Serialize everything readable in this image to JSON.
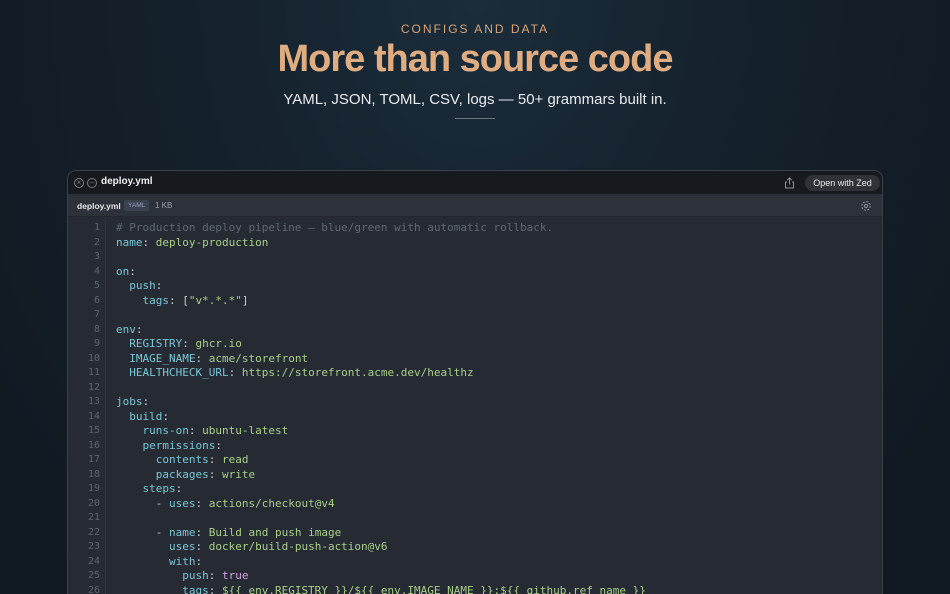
{
  "hero": {
    "eyebrow": "CONFIGS AND DATA",
    "headline": "More than source code",
    "subhead": "YAML, JSON, TOML, CSV, logs — 50+ grammars built in."
  },
  "window": {
    "title": "deploy.yml",
    "open_button": "Open with Zed",
    "icons": [
      "close-icon",
      "minimize-icon",
      "share-icon",
      "gear-icon"
    ],
    "tab": {
      "file": "deploy.yml",
      "language": "YAML",
      "size": "1 KB"
    }
  },
  "colors": {
    "accent": "#e0ad82",
    "key": "#79c7d8",
    "string": "#a8cf8a",
    "boolean": "#d7a2e6",
    "comment": "#5f6873"
  },
  "code_lines": [
    {
      "num": "1",
      "parts": [
        {
          "t": "# Production deploy pipeline — blue/green with automatic rollback.",
          "c": "comment"
        }
      ]
    },
    {
      "num": "2",
      "parts": [
        {
          "t": "name",
          "c": "key"
        },
        {
          "t": ": ",
          "c": "punct"
        },
        {
          "t": "deploy-production",
          "c": "str"
        }
      ]
    },
    {
      "num": "3",
      "parts": []
    },
    {
      "num": "4",
      "parts": [
        {
          "t": "on",
          "c": "key"
        },
        {
          "t": ":",
          "c": "punct"
        }
      ]
    },
    {
      "num": "5",
      "parts": [
        {
          "t": "  push",
          "c": "key"
        },
        {
          "t": ":",
          "c": "punct"
        }
      ]
    },
    {
      "num": "6",
      "parts": [
        {
          "t": "    tags",
          "c": "key"
        },
        {
          "t": ": [",
          "c": "punct"
        },
        {
          "t": "\"v*.*.*\"",
          "c": "str"
        },
        {
          "t": "]",
          "c": "punct"
        }
      ]
    },
    {
      "num": "7",
      "parts": []
    },
    {
      "num": "8",
      "parts": [
        {
          "t": "env",
          "c": "key"
        },
        {
          "t": ":",
          "c": "punct"
        }
      ]
    },
    {
      "num": "9",
      "parts": [
        {
          "t": "  REGISTRY",
          "c": "key"
        },
        {
          "t": ": ",
          "c": "punct"
        },
        {
          "t": "ghcr.io",
          "c": "str"
        }
      ]
    },
    {
      "num": "10",
      "parts": [
        {
          "t": "  IMAGE_NAME",
          "c": "key"
        },
        {
          "t": ": ",
          "c": "punct"
        },
        {
          "t": "acme/storefront",
          "c": "str"
        }
      ]
    },
    {
      "num": "11",
      "parts": [
        {
          "t": "  HEALTHCHECK_URL",
          "c": "key"
        },
        {
          "t": ": ",
          "c": "punct"
        },
        {
          "t": "https://storefront.acme.dev/healthz",
          "c": "str"
        }
      ]
    },
    {
      "num": "12",
      "parts": []
    },
    {
      "num": "13",
      "parts": [
        {
          "t": "jobs",
          "c": "key"
        },
        {
          "t": ":",
          "c": "punct"
        }
      ]
    },
    {
      "num": "14",
      "parts": [
        {
          "t": "  build",
          "c": "key"
        },
        {
          "t": ":",
          "c": "punct"
        }
      ]
    },
    {
      "num": "15",
      "parts": [
        {
          "t": "    runs-on",
          "c": "key"
        },
        {
          "t": ": ",
          "c": "punct"
        },
        {
          "t": "ubuntu-latest",
          "c": "str"
        }
      ]
    },
    {
      "num": "16",
      "parts": [
        {
          "t": "    permissions",
          "c": "key"
        },
        {
          "t": ":",
          "c": "punct"
        }
      ]
    },
    {
      "num": "17",
      "parts": [
        {
          "t": "      contents",
          "c": "key"
        },
        {
          "t": ": ",
          "c": "punct"
        },
        {
          "t": "read",
          "c": "str"
        }
      ]
    },
    {
      "num": "18",
      "parts": [
        {
          "t": "      packages",
          "c": "key"
        },
        {
          "t": ": ",
          "c": "punct"
        },
        {
          "t": "write",
          "c": "str"
        }
      ]
    },
    {
      "num": "19",
      "parts": [
        {
          "t": "    steps",
          "c": "key"
        },
        {
          "t": ":",
          "c": "punct"
        }
      ]
    },
    {
      "num": "20",
      "parts": [
        {
          "t": "      - ",
          "c": "punct"
        },
        {
          "t": "uses",
          "c": "key"
        },
        {
          "t": ": ",
          "c": "punct"
        },
        {
          "t": "actions/checkout@v4",
          "c": "str"
        }
      ]
    },
    {
      "num": "21",
      "parts": []
    },
    {
      "num": "22",
      "parts": [
        {
          "t": "      - ",
          "c": "punct"
        },
        {
          "t": "name",
          "c": "key"
        },
        {
          "t": ": ",
          "c": "punct"
        },
        {
          "t": "Build and push image",
          "c": "str"
        }
      ]
    },
    {
      "num": "23",
      "parts": [
        {
          "t": "        uses",
          "c": "key"
        },
        {
          "t": ": ",
          "c": "punct"
        },
        {
          "t": "docker/build-push-action@v6",
          "c": "str"
        }
      ]
    },
    {
      "num": "24",
      "parts": [
        {
          "t": "        with",
          "c": "key"
        },
        {
          "t": ":",
          "c": "punct"
        }
      ]
    },
    {
      "num": "25",
      "parts": [
        {
          "t": "          push",
          "c": "key"
        },
        {
          "t": ": ",
          "c": "punct"
        },
        {
          "t": "true",
          "c": "bool"
        }
      ]
    },
    {
      "num": "26",
      "parts": [
        {
          "t": "          tags",
          "c": "key"
        },
        {
          "t": ": ",
          "c": "punct"
        },
        {
          "t": "${{ env.REGISTRY }}/${{ env.IMAGE_NAME }}:${{ github.ref_name }}",
          "c": "str"
        }
      ]
    }
  ]
}
